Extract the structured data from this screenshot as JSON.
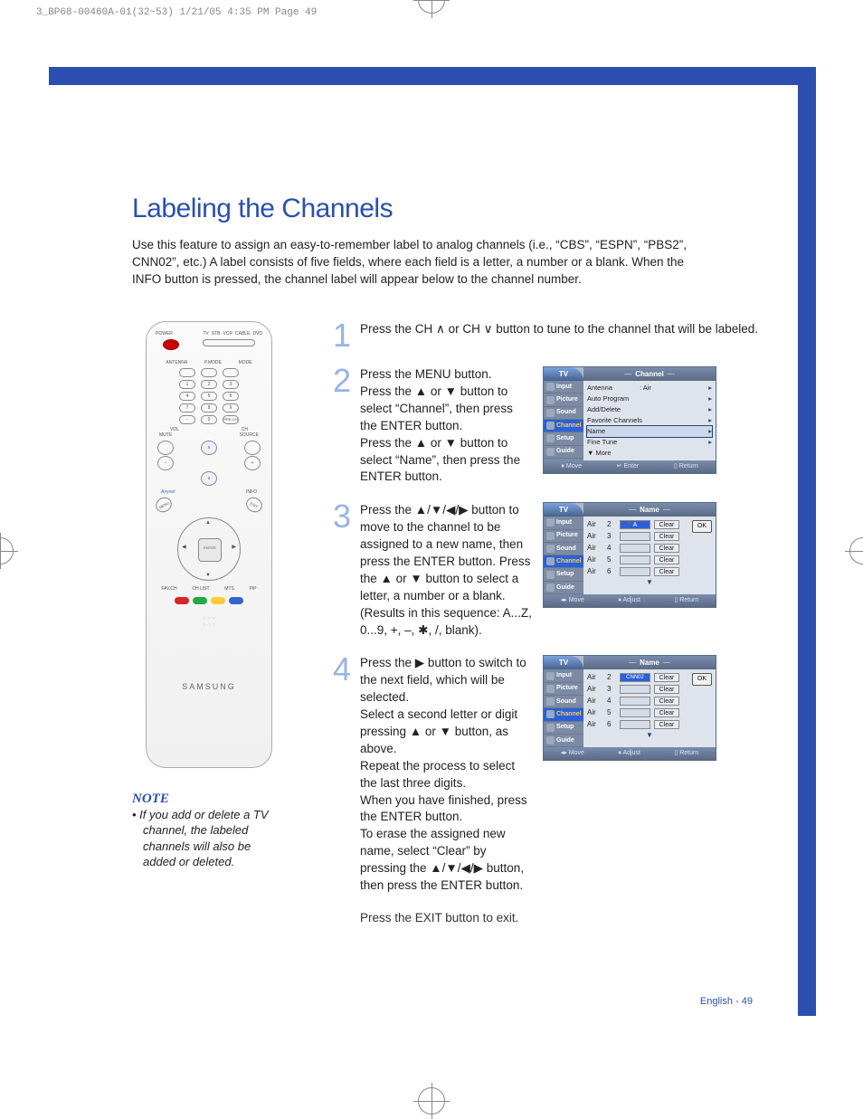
{
  "header_tag": "3_BP68-00460A-01(32~53)  1/21/05  4:35 PM  Page 49",
  "title": "Labeling the Channels",
  "intro": "Use this feature to assign an easy-to-remember label to analog channels (i.e., “CBS”, “ESPN”, “PBS2”, CNN02”, etc.) A label consists of five fields, where each field is a letter, a number or a blank. When the INFO button is pressed, the channel label will appear below to the channel number.",
  "note": {
    "heading": "NOTE",
    "body": "• If you add or delete a TV channel, the labeled channels will also be added or deleted."
  },
  "steps": {
    "s1": "Press the CH ∧ or CH ∨ button to tune to the channel that will be labeled.",
    "s2": "Press the MENU button.\nPress the ▲ or ▼ button to select “Channel”, then press the ENTER button.\nPress the ▲ or ▼ button to select “Name”, then press the ENTER button.",
    "s3": "Press the ▲/▼/◀/▶ button to move to the channel to be assigned to a new name, then press the ENTER button. Press the ▲ or ▼ button to select a letter, a number or a blank. (Results in this sequence: A...Z, 0...9, +, –, ✱, /, blank).",
    "s4": "Press the ▶ button to switch to the next field, which will be selected.\nSelect a second letter or digit pressing ▲ or ▼ button, as above.\nRepeat the process to select the last three digits.\nWhen you have finished, press the ENTER button.\nTo erase the assigned new name, select “Clear” by pressing the ▲/▼/◀/▶ button, then press the ENTER button.",
    "exit": "Press the EXIT button to exit."
  },
  "remote": {
    "labels": {
      "power": "POWER",
      "modes": [
        "TV",
        "STB",
        "VCR",
        "CABLE",
        "DVD"
      ],
      "antenna": "ANTENNA",
      "pmode": "P.MODE",
      "mode": "MODE",
      "prech": "PRE-CH",
      "vol": "VOL",
      "ch": "CH",
      "mute": "MUTE",
      "source": "SOURCE",
      "info": "INFO",
      "enter": "ENTER",
      "favch": "FAV.CH",
      "chlist": "CH LIST",
      "mts": "MTS",
      "pip": "PIP",
      "brand": "SAMSUNG"
    }
  },
  "osd": {
    "tv_tab": "TV",
    "side_items": [
      "Input",
      "Picture",
      "Sound",
      "Channel",
      "Setup",
      "Guide"
    ],
    "footer_move": "Move",
    "footer_enter": "Enter",
    "footer_return": "Return",
    "footer_adjust": "Adjust",
    "channel": {
      "title": "Channel",
      "rows": [
        {
          "label": "Antenna",
          "value": ": Air"
        },
        {
          "label": "Auto Program"
        },
        {
          "label": "Add/Delete"
        },
        {
          "label": "Favorite Channels"
        },
        {
          "label": "Name",
          "selected": true
        },
        {
          "label": "Fine Tune"
        },
        {
          "label": "▼ More"
        }
      ]
    },
    "name1": {
      "title": "Name",
      "ok": "OK",
      "rows": [
        {
          "air": "Air",
          "ch": "2",
          "cursor": "A"
        },
        {
          "air": "Air",
          "ch": "3"
        },
        {
          "air": "Air",
          "ch": "4"
        },
        {
          "air": "Air",
          "ch": "5"
        },
        {
          "air": "Air",
          "ch": "6"
        }
      ],
      "clear": "Clear",
      "more": "▼"
    },
    "name2": {
      "title": "Name",
      "ok": "OK",
      "rows": [
        {
          "air": "Air",
          "ch": "2",
          "val": "CNN02"
        },
        {
          "air": "Air",
          "ch": "3"
        },
        {
          "air": "Air",
          "ch": "4"
        },
        {
          "air": "Air",
          "ch": "5"
        },
        {
          "air": "Air",
          "ch": "6"
        }
      ],
      "clear": "Clear",
      "more": "▼"
    }
  },
  "page_num": "English - 49"
}
